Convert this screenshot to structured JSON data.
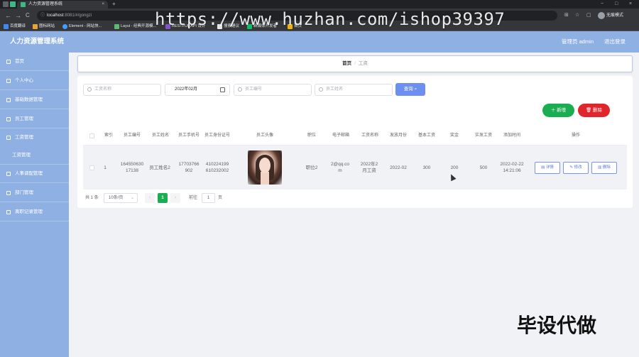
{
  "browser": {
    "tab_title": "人力资源管理系统",
    "tab_close": "×",
    "new_tab": "+",
    "url_host": "localhost",
    "url_path": ":8081/#/gongzi",
    "profile_label": "无痕模式",
    "nav_back": "←",
    "nav_forward": "→",
    "nav_reload": "C",
    "win_min": "−",
    "win_max": "□",
    "win_close": "×",
    "bookmarks": [
      "百度翻译",
      "图标网站",
      "Element - 网站快...",
      "Layui - 经典开源模...",
      "RESTFUL API 设计",
      "搜索建议",
      "新媒体开发者",
      "首页"
    ],
    "colors": {
      "favicon": "#41b883"
    }
  },
  "watermark": "https://www.huzhan.com/ishop39397",
  "app": {
    "title": "人力资源管理系统",
    "user": "管理员 admin",
    "logout": "退出登录",
    "colors": {
      "header": "#8fb0e3",
      "primary_button": "#6d8ff0",
      "add_button": "#1aad52",
      "delete_button": "#e0262d"
    }
  },
  "sidebar": {
    "items": [
      {
        "label": "首页",
        "icon": "home-icon"
      },
      {
        "label": "个人中心",
        "icon": "user-icon"
      },
      {
        "label": "基础数据管理",
        "icon": "database-icon"
      },
      {
        "label": "员工管理",
        "icon": "people-icon"
      },
      {
        "label": "工资管理",
        "icon": "money-icon"
      },
      {
        "label": "工资管理",
        "icon": ""
      },
      {
        "label": "人事调配管理",
        "icon": "transfer-icon"
      },
      {
        "label": "部门管理",
        "icon": "dept-icon"
      },
      {
        "label": "离职记录管理",
        "icon": "record-icon"
      }
    ]
  },
  "breadcrumb": {
    "home": "首页",
    "separator": "/",
    "current": "工资"
  },
  "filters": {
    "name_placeholder": "工资名称",
    "month_value": "2022年02月",
    "emp_no_placeholder": "员工编号",
    "emp_name_placeholder": "员工姓名",
    "search_label": "查询"
  },
  "actions": {
    "add_label": "新增",
    "delete_label": "删除"
  },
  "table": {
    "headers": [
      "索引",
      "员工编号",
      "员工姓名",
      "员工手机号",
      "员工身份证号",
      "员工头像",
      "职位",
      "电子邮箱",
      "工资名称",
      "发放月份",
      "基本工资",
      "奖金",
      "实发工资",
      "添加时间",
      "操作"
    ],
    "rows": [
      {
        "index": "1",
        "emp_no": "16455063017138",
        "emp_name": "员工姓名2",
        "phone": "17703766902",
        "id_card": "410224199610232002",
        "position": "职位2",
        "email": "2@qq.com",
        "salary_name": "2022年2月工资",
        "month": "2022-02",
        "base": "300",
        "bonus": "200",
        "actual": "500",
        "added": "2022-02-22 14:21:06"
      }
    ],
    "ops": {
      "detail": "详情",
      "edit": "修改",
      "delete": "删除"
    }
  },
  "pagination": {
    "total": "共 1 条",
    "page_size": "10条/页",
    "current_page": "1",
    "goto_label": "前往",
    "goto_value": "1",
    "page_suffix": "页",
    "prev": "‹",
    "next": "›"
  },
  "promo": "毕设代做"
}
